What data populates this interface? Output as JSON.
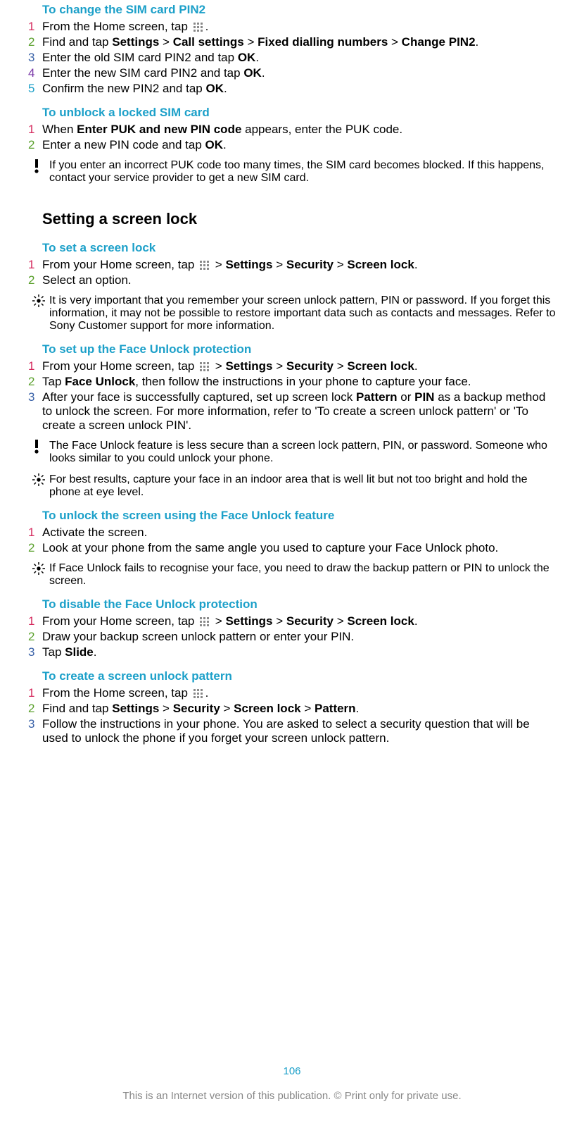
{
  "sections": {
    "changePin2": {
      "heading": "To change the SIM card PIN2",
      "steps": [
        {
          "n": "1",
          "c": "c1",
          "pre": "From the Home screen, tap ",
          "icon": true,
          "post": "."
        },
        {
          "n": "2",
          "c": "c2",
          "html": "Find and tap <b>Settings</b> > <b>Call settings</b> > <b>Fixed dialling numbers</b> > <b>Change PIN2</b>."
        },
        {
          "n": "3",
          "c": "c3",
          "html": "Enter the old SIM card PIN2 and tap <b>OK</b>."
        },
        {
          "n": "4",
          "c": "c4",
          "html": "Enter the new SIM card PIN2 and tap <b>OK</b>."
        },
        {
          "n": "5",
          "c": "c5",
          "html": "Confirm the new PIN2 and tap <b>OK</b>."
        }
      ]
    },
    "unblockSim": {
      "heading": "To unblock a locked SIM card",
      "steps": [
        {
          "n": "1",
          "c": "c1",
          "html": "When <b>Enter PUK and new PIN code</b> appears, enter the PUK code."
        },
        {
          "n": "2",
          "c": "c2",
          "html": "Enter a new PIN code and tap <b>OK</b>."
        }
      ],
      "warning": "If you enter an incorrect PUK code too many times, the SIM card becomes blocked. If this happens, contact your service provider to get a new SIM card."
    },
    "mainHeading": "Setting a screen lock",
    "setScreenLock": {
      "heading": "To set a screen lock",
      "steps": [
        {
          "n": "1",
          "c": "c1",
          "pre": "From your Home screen, tap ",
          "icon": true,
          "post": " > <b>Settings</b> > <b>Security</b> > <b>Screen lock</b>."
        },
        {
          "n": "2",
          "c": "c2",
          "html": "Select an option."
        }
      ],
      "tip": "It is very important that you remember your screen unlock pattern, PIN or password. If you forget this information, it may not be possible to restore important data such as contacts and messages. Refer to Sony Customer support for more information."
    },
    "faceUnlock": {
      "heading": "To set up the Face Unlock protection",
      "steps": [
        {
          "n": "1",
          "c": "c1",
          "pre": "From your Home screen, tap ",
          "icon": true,
          "post": " > <b>Settings</b> > <b>Security</b> > <b>Screen lock</b>."
        },
        {
          "n": "2",
          "c": "c2",
          "html": "Tap <b>Face Unlock</b>, then follow the instructions in your phone to capture your face."
        },
        {
          "n": "3",
          "c": "c3",
          "html": "After your face is successfully captured, set up screen lock <b>Pattern</b> or <b>PIN</b> as a backup method to unlock the screen. For more information, refer to 'To create a screen unlock pattern' or 'To create a screen unlock PIN'."
        }
      ],
      "warning": "The Face Unlock feature is less secure than a screen lock pattern, PIN, or password. Someone who looks similar to you could unlock your phone.",
      "tip": "For best results, capture your face in an indoor area that is well lit but not too bright and hold the phone at eye level."
    },
    "unlockFace": {
      "heading": "To unlock the screen using the Face Unlock feature",
      "steps": [
        {
          "n": "1",
          "c": "c1",
          "html": "Activate the screen."
        },
        {
          "n": "2",
          "c": "c2",
          "html": "Look at your phone from the same angle you used to capture your Face Unlock photo."
        }
      ],
      "tip": "If Face Unlock fails to recognise your face, you need to draw the backup pattern or PIN to unlock the screen."
    },
    "disableFace": {
      "heading": "To disable the Face Unlock protection",
      "steps": [
        {
          "n": "1",
          "c": "c1",
          "pre": "From your Home screen, tap ",
          "icon": true,
          "post": " > <b>Settings</b> > <b>Security</b> > <b>Screen lock</b>."
        },
        {
          "n": "2",
          "c": "c2",
          "html": "Draw your backup screen unlock pattern or enter your PIN."
        },
        {
          "n": "3",
          "c": "c3",
          "html": "Tap <b>Slide</b>."
        }
      ]
    },
    "createPattern": {
      "heading": "To create a screen unlock pattern",
      "steps": [
        {
          "n": "1",
          "c": "c1",
          "pre": "From the Home screen, tap ",
          "icon": true,
          "post": "."
        },
        {
          "n": "2",
          "c": "c2",
          "html": "Find and tap <b>Settings</b> > <b>Security</b> > <b>Screen lock</b> > <b>Pattern</b>."
        },
        {
          "n": "3",
          "c": "c3",
          "html": "Follow the instructions in your phone. You are asked to select a security question that will be used to unlock the phone if you forget your screen unlock pattern."
        }
      ]
    }
  },
  "pageNumber": "106",
  "footerText": "This is an Internet version of this publication. © Print only for private use."
}
